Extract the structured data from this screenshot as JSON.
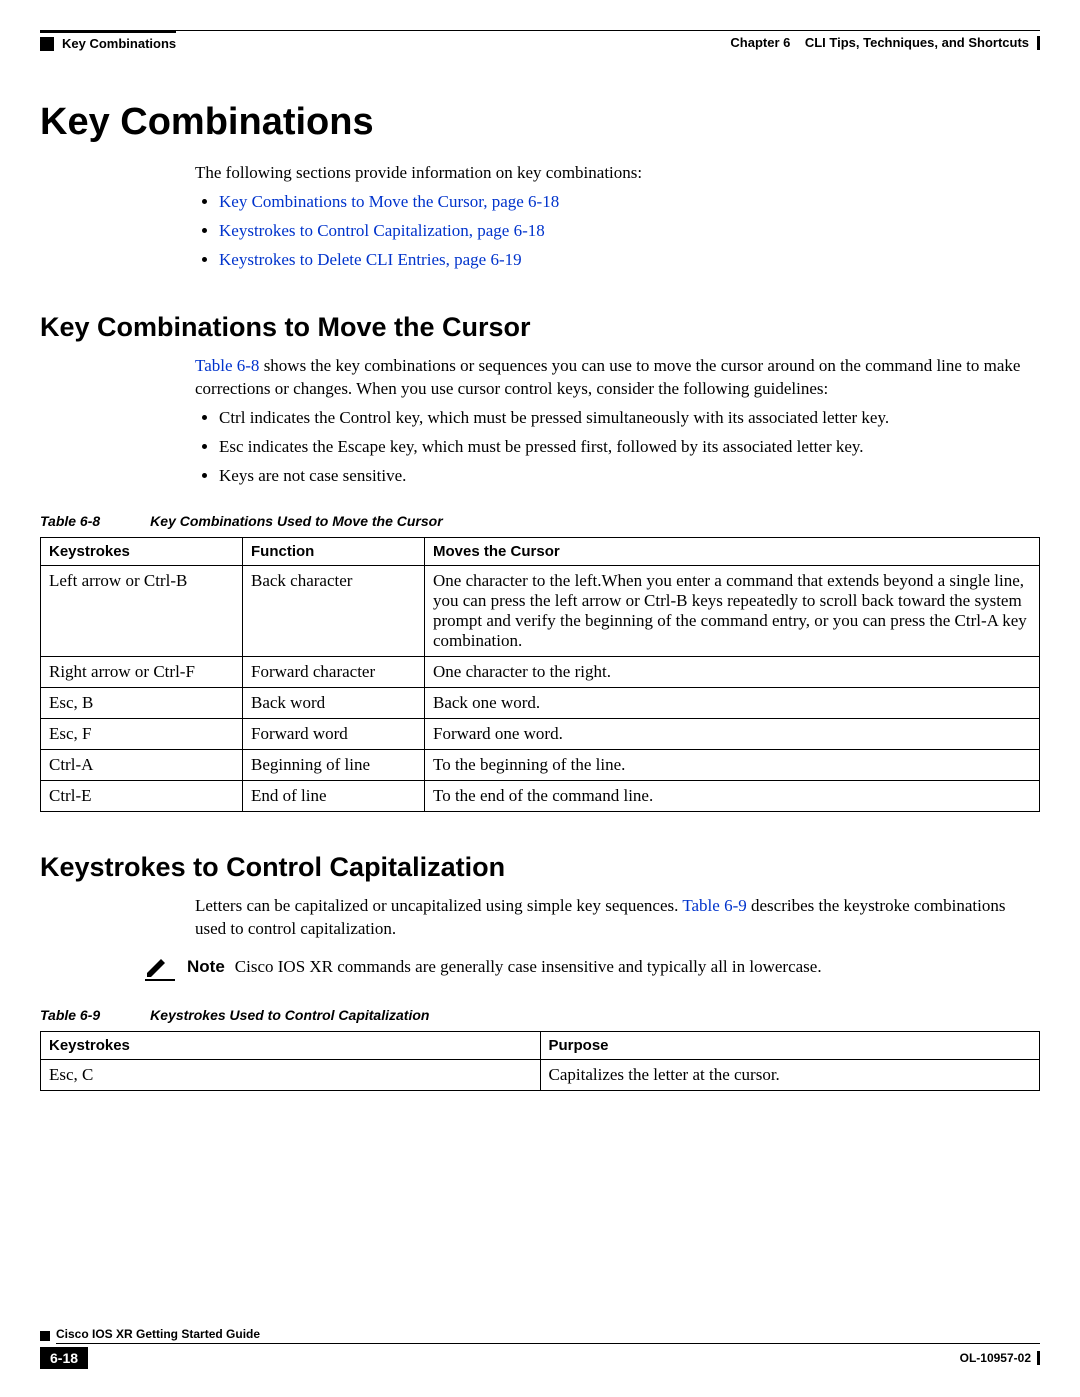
{
  "runningHeader": {
    "left": "Key Combinations",
    "rightChapter": "Chapter 6",
    "rightTitle": "CLI Tips, Techniques, and Shortcuts"
  },
  "heading": "Key Combinations",
  "intro": "The following sections provide information on key combinations:",
  "toc": [
    "Key Combinations to Move the Cursor, page 6-18",
    "Keystrokes to Control Capitalization, page 6-18",
    "Keystrokes to Delete CLI Entries, page 6-19"
  ],
  "section1": {
    "heading": "Key Combinations to Move the Cursor",
    "para_part1": "Table 6-8",
    "para_part2": " shows the key combinations or sequences you can use to move the cursor around on the command line to make corrections or changes. When you use cursor control keys, consider the following guidelines:",
    "bullets": [
      "Ctrl indicates the Control key, which must be pressed simultaneously with its associated letter key.",
      "Esc indicates the Escape key, which must be pressed first, followed by its associated letter key.",
      "Keys are not case sensitive."
    ],
    "tableCaptionLabel": "Table 6-8",
    "tableCaptionTitle": "Key Combinations Used to Move the Cursor",
    "headers": [
      "Keystrokes",
      "Function",
      "Moves the Cursor"
    ],
    "rows": [
      [
        "Left arrow or Ctrl-B",
        "Back character",
        "One character to the left.When you enter a command that extends beyond a single line, you can press the left arrow or Ctrl-B keys repeatedly to scroll back toward the system prompt and verify the beginning of the command entry, or you can press the Ctrl-A key combination."
      ],
      [
        "Right arrow or Ctrl-F",
        "Forward character",
        "One character to the right."
      ],
      [
        "Esc, B",
        "Back word",
        "Back one word."
      ],
      [
        "Esc, F",
        "Forward word",
        "Forward one word."
      ],
      [
        "Ctrl-A",
        "Beginning of line",
        "To the beginning of the line."
      ],
      [
        "Ctrl-E",
        "End of line",
        "To the end of the command line."
      ]
    ]
  },
  "section2": {
    "heading": "Keystrokes to Control Capitalization",
    "para_part1": "Letters can be capitalized or uncapitalized using simple key sequences. ",
    "para_link": "Table 6-9",
    "para_part2": " describes the keystroke combinations used to control capitalization.",
    "noteLabel": "Note",
    "noteText": "Cisco IOS XR commands are generally case insensitive and typically all in lowercase.",
    "tableCaptionLabel": "Table 6-9",
    "tableCaptionTitle": "Keystrokes Used to Control Capitalization",
    "headers": [
      "Keystrokes",
      "Purpose"
    ],
    "rows": [
      [
        "Esc, C",
        "Capitalizes the letter at the cursor."
      ]
    ]
  },
  "footer": {
    "guideTitle": "Cisco IOS XR Getting Started Guide",
    "pageNumber": "6-18",
    "docId": "OL-10957-02"
  }
}
